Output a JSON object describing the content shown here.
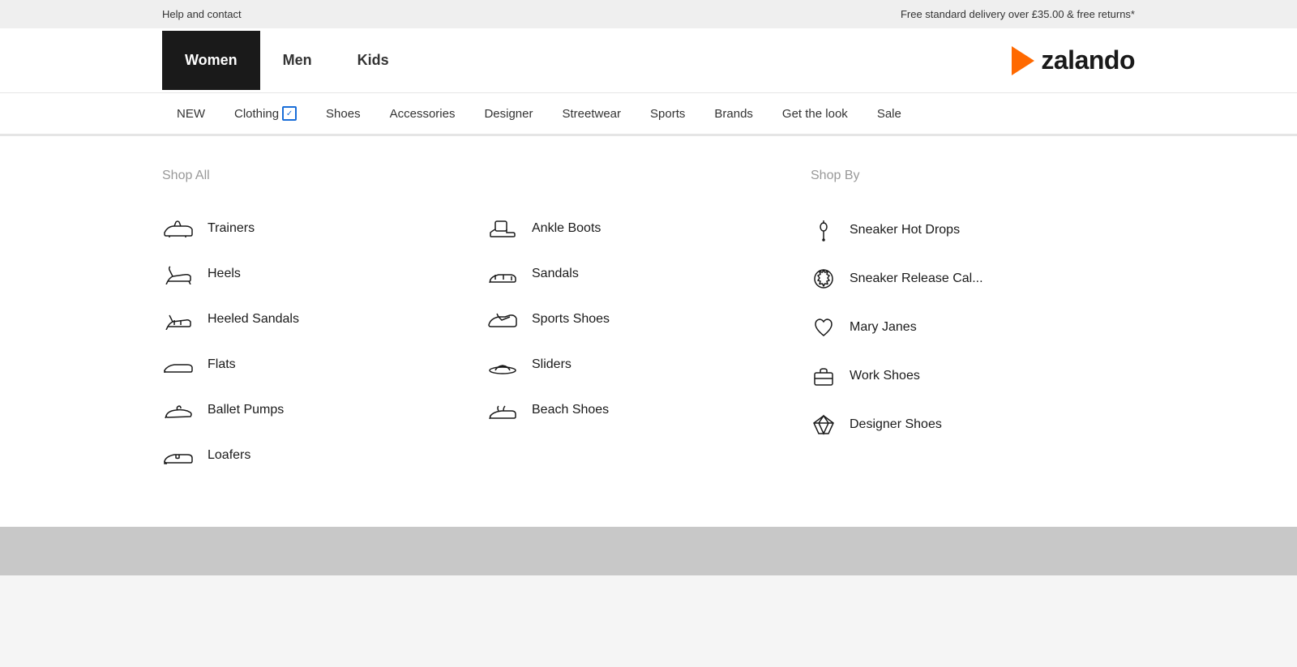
{
  "topBanner": {
    "helpText": "Help and contact",
    "deliveryText": "Free standard delivery over £35.00 & free returns*"
  },
  "header": {
    "navTabs": [
      {
        "id": "women",
        "label": "Women",
        "active": true
      },
      {
        "id": "men",
        "label": "Men",
        "active": false
      },
      {
        "id": "kids",
        "label": "Kids",
        "active": false
      }
    ],
    "logoText": "zalando"
  },
  "categoryNav": {
    "items": [
      {
        "id": "new",
        "label": "NEW",
        "hasDropdown": false
      },
      {
        "id": "clothing",
        "label": "Clothing",
        "hasDropdown": true
      },
      {
        "id": "shoes",
        "label": "Shoes",
        "hasDropdown": false
      },
      {
        "id": "accessories",
        "label": "Accessories",
        "hasDropdown": false
      },
      {
        "id": "designer",
        "label": "Designer",
        "hasDropdown": false
      },
      {
        "id": "streetwear",
        "label": "Streetwear",
        "hasDropdown": false
      },
      {
        "id": "sports",
        "label": "Sports",
        "hasDropdown": false
      },
      {
        "id": "brands",
        "label": "Brands",
        "hasDropdown": false
      },
      {
        "id": "get-the-look",
        "label": "Get the look",
        "hasDropdown": false
      },
      {
        "id": "sale",
        "label": "Sale",
        "hasDropdown": false
      }
    ]
  },
  "dropdown": {
    "shopAllTitle": "Shop All",
    "shopByTitle": "Shop By",
    "leftColumn": [
      {
        "id": "trainers",
        "label": "Trainers",
        "icon": "trainers"
      },
      {
        "id": "heels",
        "label": "Heels",
        "icon": "heels"
      },
      {
        "id": "heeled-sandals",
        "label": "Heeled Sandals",
        "icon": "heeled-sandals"
      },
      {
        "id": "flats",
        "label": "Flats",
        "icon": "flats"
      },
      {
        "id": "ballet-pumps",
        "label": "Ballet Pumps",
        "icon": "ballet-pumps"
      },
      {
        "id": "loafers",
        "label": "Loafers",
        "icon": "loafers"
      }
    ],
    "midColumn": [
      {
        "id": "ankle-boots",
        "label": "Ankle Boots",
        "icon": "ankle-boots"
      },
      {
        "id": "sandals",
        "label": "Sandals",
        "icon": "sandals"
      },
      {
        "id": "sports-shoes",
        "label": "Sports Shoes",
        "icon": "sports-shoes"
      },
      {
        "id": "sliders",
        "label": "Sliders",
        "icon": "sliders"
      },
      {
        "id": "beach-shoes",
        "label": "Beach Shoes",
        "icon": "beach-shoes"
      }
    ],
    "rightColumn": [
      {
        "id": "sneaker-hot-drops",
        "label": "Sneaker Hot Drops",
        "icon": "pin"
      },
      {
        "id": "sneaker-release-cal",
        "label": "Sneaker Release Cal...",
        "icon": "badge"
      },
      {
        "id": "mary-janes",
        "label": "Mary Janes",
        "icon": "heart"
      },
      {
        "id": "work-shoes",
        "label": "Work Shoes",
        "icon": "briefcase"
      },
      {
        "id": "designer-shoes",
        "label": "Designer Shoes",
        "icon": "diamond"
      }
    ]
  }
}
